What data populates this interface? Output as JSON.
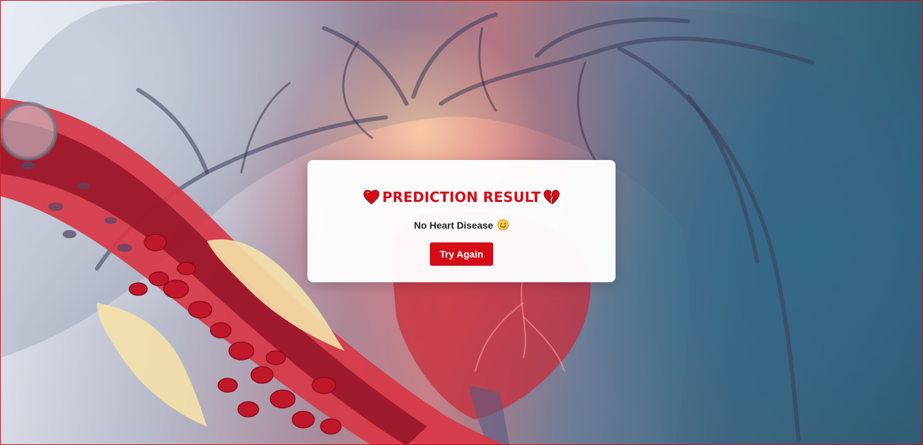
{
  "result": {
    "title": "PREDICTION RESULT",
    "title_left_icon": "red-heart-icon",
    "title_right_icon": "broken-heart-icon",
    "message": "No Heart Disease",
    "message_icon": "smiling-face-icon",
    "button_label": "Try Again"
  },
  "background": {
    "subject": "heart-and-artery-illustration"
  },
  "colors": {
    "accent": "#d40d16",
    "frame_border": "#c8161d",
    "card": "#ffffff",
    "text": "#222222"
  }
}
